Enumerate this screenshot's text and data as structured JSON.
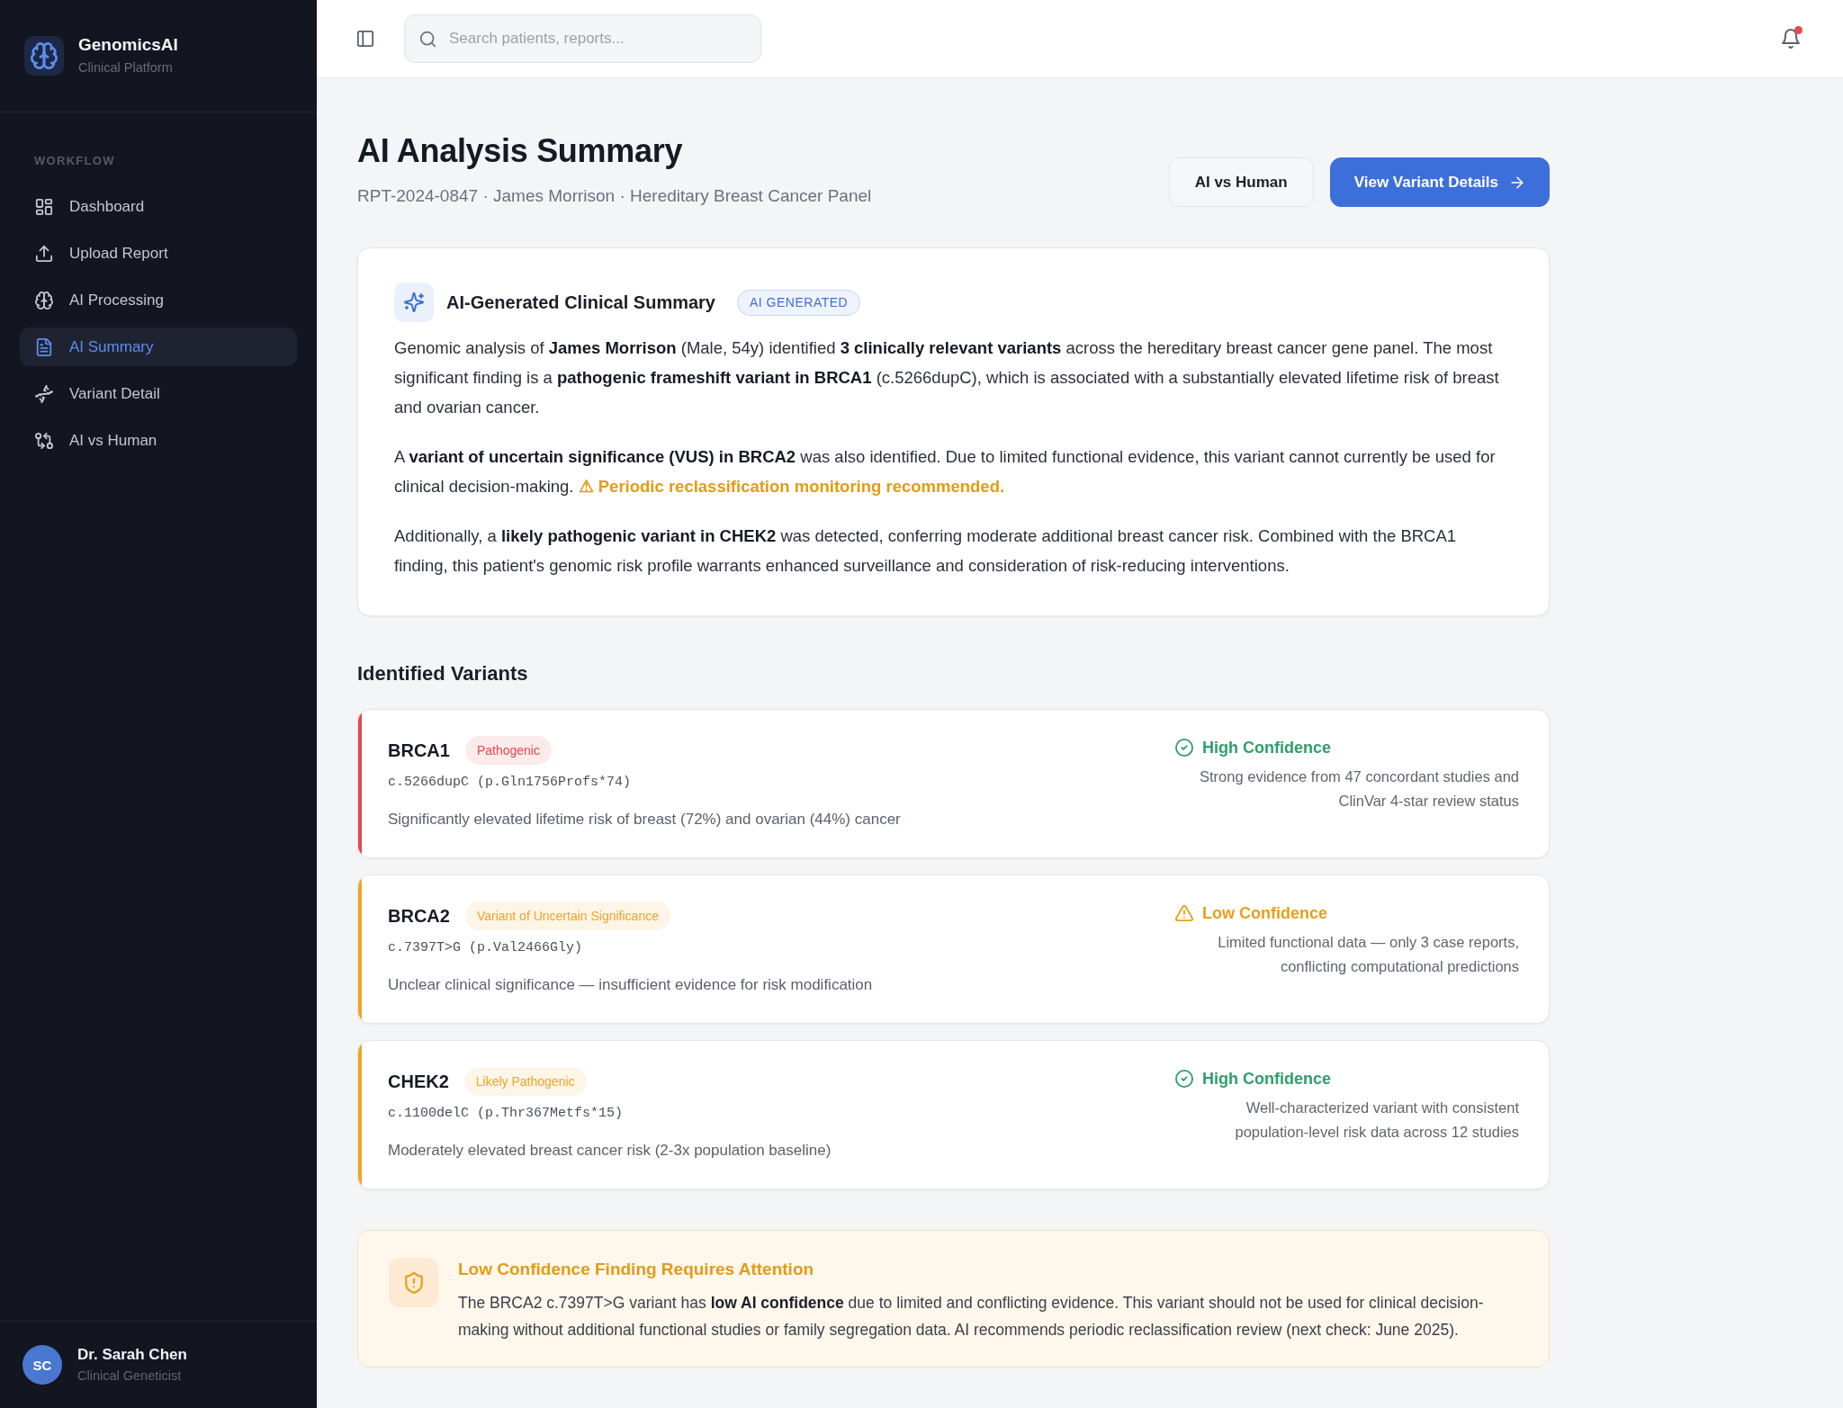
{
  "sidebar": {
    "brand": {
      "name": "GenomicsAI",
      "tagline": "Clinical Platform"
    },
    "section_label": "WORKFLOW",
    "items": [
      {
        "label": "Dashboard",
        "selected": false
      },
      {
        "label": "Upload Report",
        "selected": false
      },
      {
        "label": "AI Processing",
        "selected": false
      },
      {
        "label": "AI Summary",
        "selected": true
      },
      {
        "label": "Variant Detail",
        "selected": false
      },
      {
        "label": "AI vs Human",
        "selected": false
      }
    ],
    "user": {
      "initials": "SC",
      "name": "Dr. Sarah Chen",
      "role": "Clinical Geneticist"
    }
  },
  "header": {
    "search": {
      "placeholder": "Search patients, reports..."
    },
    "notifications": {
      "unread": true
    }
  },
  "page": {
    "title": "AI Analysis Summary",
    "subtitle": "RPT-2024-0847 · James Morrison · Hereditary Breast Cancer Panel",
    "buttons": [
      {
        "label": "AI vs Human",
        "kind": "secondary"
      },
      {
        "label": "View Variant Details",
        "kind": "primary"
      }
    ]
  },
  "summary": {
    "title": "AI-Generated Clinical Summary",
    "badge": "AI GENERATED",
    "paragraphs": [
      {
        "text": "Genomic analysis of **James Morrison** (Male, 54y) identified **3 clinically relevant variants** across the hereditary breast cancer gene panel. The most significant finding is a **pathogenic frameshift variant in BRCA1** (c.5266dupC), which is associated with a substantially elevated lifetime risk of breast and ovarian cancer."
      },
      {
        "text": "A **variant of uncertain significance (VUS) in BRCA2** was also identified. Due to limited functional evidence, this variant cannot currently be used for clinical decision-making.",
        "note": "⚠ Periodic reclassification monitoring recommended."
      },
      {
        "text": "Additionally, a **likely pathogenic variant in CHEK2** was detected, conferring moderate additional breast cancer risk. Combined with the BRCA1 finding, this patient's genomic risk profile warrants enhanced surveillance and consideration of risk-reducing interventions."
      }
    ]
  },
  "variants_section": {
    "title": "Identified Variants",
    "variants": [
      {
        "gene": "BRCA1",
        "classification": "Pathogenic",
        "color": "#e5484d",
        "notation": "c.5266dupC (p.Gln1756Profs*74)",
        "description": "Significantly elevated lifetime risk of breast (72%) and ovarian (44%) cancer",
        "confidence": {
          "label": "High Confidence",
          "kind": "high"
        },
        "evidence": "Strong evidence from 47 concordant studies and ClinVar 4-star review status"
      },
      {
        "gene": "BRCA2",
        "classification": "Variant of Uncertain Significance",
        "color": "#f0a422",
        "notation": "c.7397T>G (p.Val2466Gly)",
        "description": "Unclear clinical significance — insufficient evidence for risk modification",
        "confidence": {
          "label": "Low Confidence",
          "kind": "low"
        },
        "evidence": "Limited functional data — only 3 case reports, conflicting computational predictions"
      },
      {
        "gene": "CHEK2",
        "classification": "Likely Pathogenic",
        "color": "#f0a422",
        "notation": "c.1100delC (p.Thr367Metfs*15)",
        "description": "Moderately elevated breast cancer risk (2-3x population baseline)",
        "confidence": {
          "label": "High Confidence",
          "kind": "high"
        },
        "evidence": "Well-characterized variant with consistent population-level risk data across 12 studies"
      }
    ]
  },
  "alert": {
    "title": "Low Confidence Finding Requires Attention",
    "text": "The BRCA2 c.7397T>G variant has **low AI confidence** due to limited and conflicting evidence. This variant should not be used for clinical decision-making without additional functional studies or family segregation data. AI recommends periodic reclassification review (next check: June 2025)."
  }
}
